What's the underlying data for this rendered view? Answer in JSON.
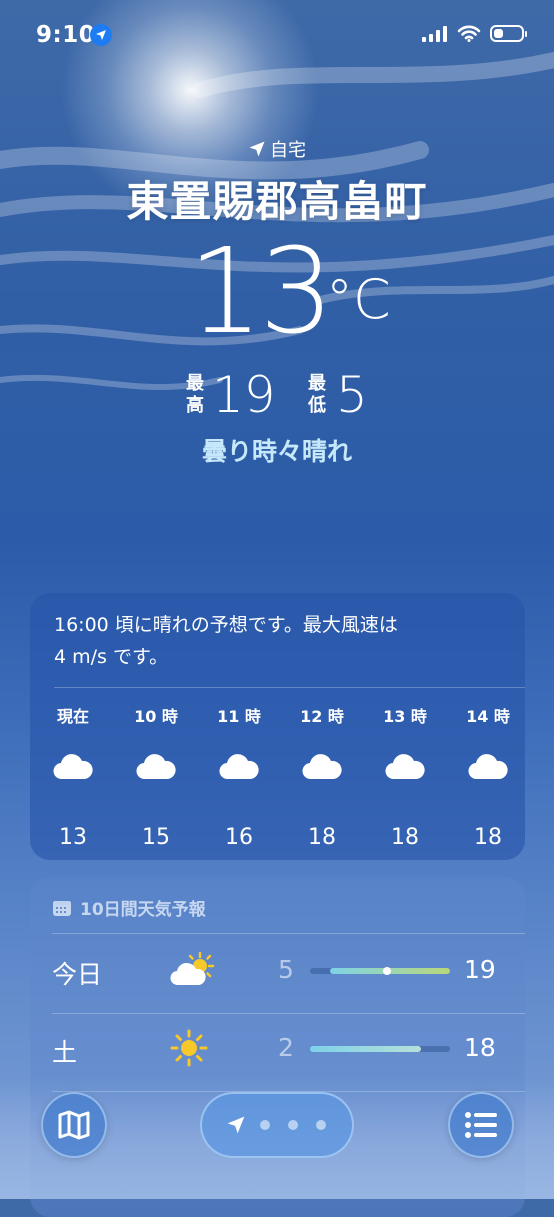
{
  "status_bar": {
    "time": "9:10",
    "icons": [
      "location-arrow-icon",
      "cellular-signal-icon",
      "wifi-icon",
      "battery-icon"
    ],
    "battery_level": 0.35
  },
  "location": {
    "home_label": "自宅",
    "city": "東置賜郡高畠町"
  },
  "current": {
    "temperature": "13",
    "unit": "°C",
    "high_label": "最高",
    "high": "19",
    "low_label": "最低",
    "low": "5",
    "condition": "曇り時々晴れ"
  },
  "hourly": {
    "summary_line1": "16:00 頃に晴れの予想です。最大風速は",
    "summary_line2": "4 m/s です。",
    "items": [
      {
        "time": "現在",
        "icon": "cloud-icon",
        "temp": "13"
      },
      {
        "time": "10 時",
        "icon": "cloud-icon",
        "temp": "15"
      },
      {
        "time": "11 時",
        "icon": "cloud-icon",
        "temp": "16"
      },
      {
        "time": "12 時",
        "icon": "cloud-icon",
        "temp": "18"
      },
      {
        "time": "13 時",
        "icon": "cloud-icon",
        "temp": "18"
      },
      {
        "time": "14 時",
        "icon": "cloud-icon",
        "temp": "18"
      }
    ]
  },
  "forecast": {
    "header": "10日間天気予報",
    "header_icon": "calendar-icon",
    "days": [
      {
        "day": "今日",
        "icon": "partly-cloudy-icon",
        "low": "5",
        "high": "19",
        "range_start": 0.14,
        "range_end": 1.0,
        "current_marker": 0.55,
        "colors": [
          "#7ed3e6",
          "#b9d77a"
        ]
      },
      {
        "day": "土",
        "icon": "sun-icon",
        "low": "2",
        "high": "18",
        "range_start": 0.0,
        "range_end": 0.79,
        "colors": [
          "#7dd2ea",
          "#b6e0d8"
        ]
      }
    ]
  },
  "toolbar": {
    "map_icon": "map-icon",
    "location_icon": "location-arrow-icon",
    "page_count": 4,
    "list_icon": "list-icon"
  },
  "colors": {
    "condition_text": "#c6e8fb",
    "location_badge": "#1e7cf2",
    "sun_yellow": "#f7c829"
  }
}
